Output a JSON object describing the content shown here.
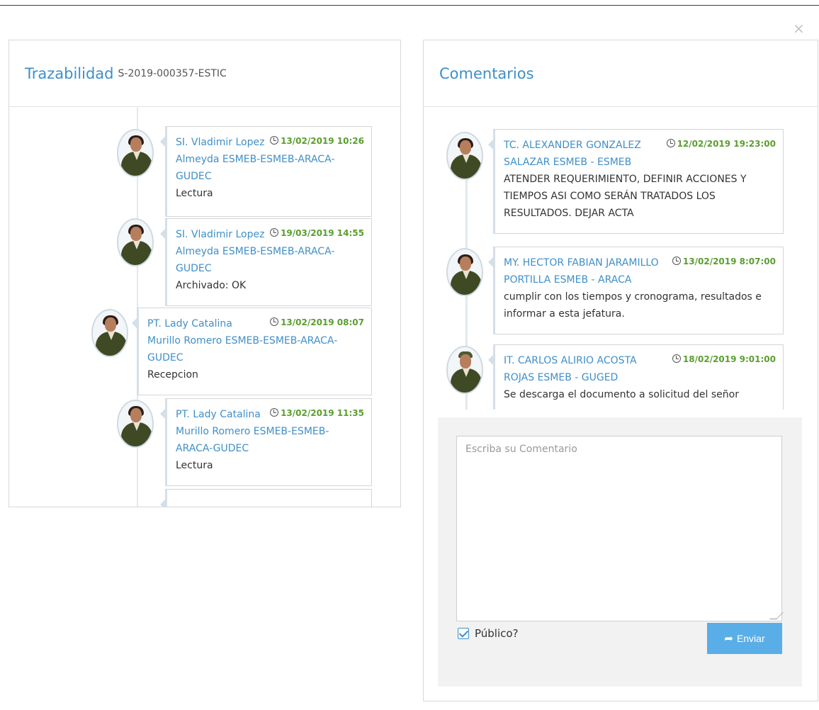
{
  "modal": {
    "close_glyph": "×"
  },
  "left": {
    "title": "Trazabilidad",
    "subtitle": "S-2019-000357-ESTIC",
    "items": [
      {
        "who": "SI. Vladimir Lopez Almeyda ESMEB-ESMEB-ARACA-GUDEC",
        "date": "13/02/2019 10:26",
        "action": "Lectura"
      },
      {
        "who": "SI. Vladimir Lopez Almeyda ESMEB-ESMEB-ARACA-GUDEC",
        "date": "19/03/2019 14:55",
        "action": "Archivado: OK"
      },
      {
        "who": "PT. Lady Catalina Murillo Romero ESMEB-ESMEB-ARACA-GUDEC",
        "date": "13/02/2019 08:07",
        "action": "Recepcion"
      },
      {
        "who": "PT. Lady Catalina Murillo Romero ESMEB-ESMEB-ARACA-GUDEC",
        "date": "13/02/2019 11:35",
        "action": "Lectura"
      }
    ]
  },
  "right": {
    "title": "Comentarios",
    "comments": [
      {
        "who": "TC. ALEXANDER GONZALEZ SALAZAR ESMEB - ESMEB",
        "date": "12/02/2019 19:23:00",
        "text": "ATENDER REQUERIMIENTO, DEFINIR ACCIONES Y TIEMPOS ASI COMO SERÁN TRATADOS LOS RESULTADOS. DEJAR ACTA"
      },
      {
        "who": "MY. HECTOR FABIAN JARAMILLO PORTILLA ESMEB - ARACA",
        "date": "13/02/2019 8:07:00",
        "text": "cumplir con los tiempos y cronograma, resultados e informar a esta jefatura."
      },
      {
        "who": "IT. CARLOS ALIRIO ACOSTA ROJAS ESMEB - GUGED",
        "date": "18/02/2019 9:01:00",
        "text": "Se descarga el documento a solicitud del señor"
      }
    ],
    "composer": {
      "placeholder": "Escriba su Comentario",
      "public_label": "Público?",
      "public_checked": true,
      "send_label": "Enviar"
    }
  },
  "colors": {
    "accent": "#3f8fc8",
    "date": "#5a9e2f",
    "send": "#5aaee8"
  }
}
